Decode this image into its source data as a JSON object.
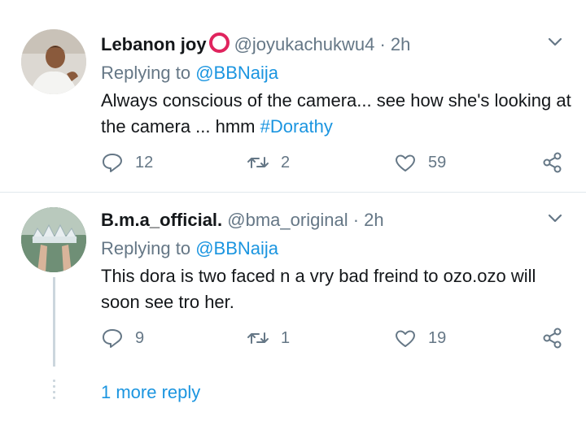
{
  "tweets": [
    {
      "name": "Lebanon joy",
      "handle": "@joyukachukwu4",
      "separator": "·",
      "time": "2h",
      "replying_prefix": "Replying to ",
      "replying_to": "@BBNaija",
      "text": "Always conscious of the camera... see how she's looking at the camera ... hmm ",
      "hashtag": "#Dorathy",
      "replies": "12",
      "retweets": "2",
      "likes": "59"
    },
    {
      "name": "B.m.a_official.",
      "handle": "@bma_original",
      "separator": "·",
      "time": "2h",
      "replying_prefix": "Replying to ",
      "replying_to": "@BBNaija",
      "text": "This dora is two faced n a vry bad freind to ozo.ozo will soon see tro her.",
      "replies": "9",
      "retweets": "1",
      "likes": "19"
    }
  ],
  "more_reply": "1 more reply",
  "colors": {
    "link": "#1b95e0",
    "muted": "#657786",
    "ring": "#e0245e",
    "divider": "#e1e8ed"
  },
  "icons": [
    "chevron-down-icon",
    "reply-icon",
    "retweet-icon",
    "heart-icon",
    "share-icon"
  ]
}
